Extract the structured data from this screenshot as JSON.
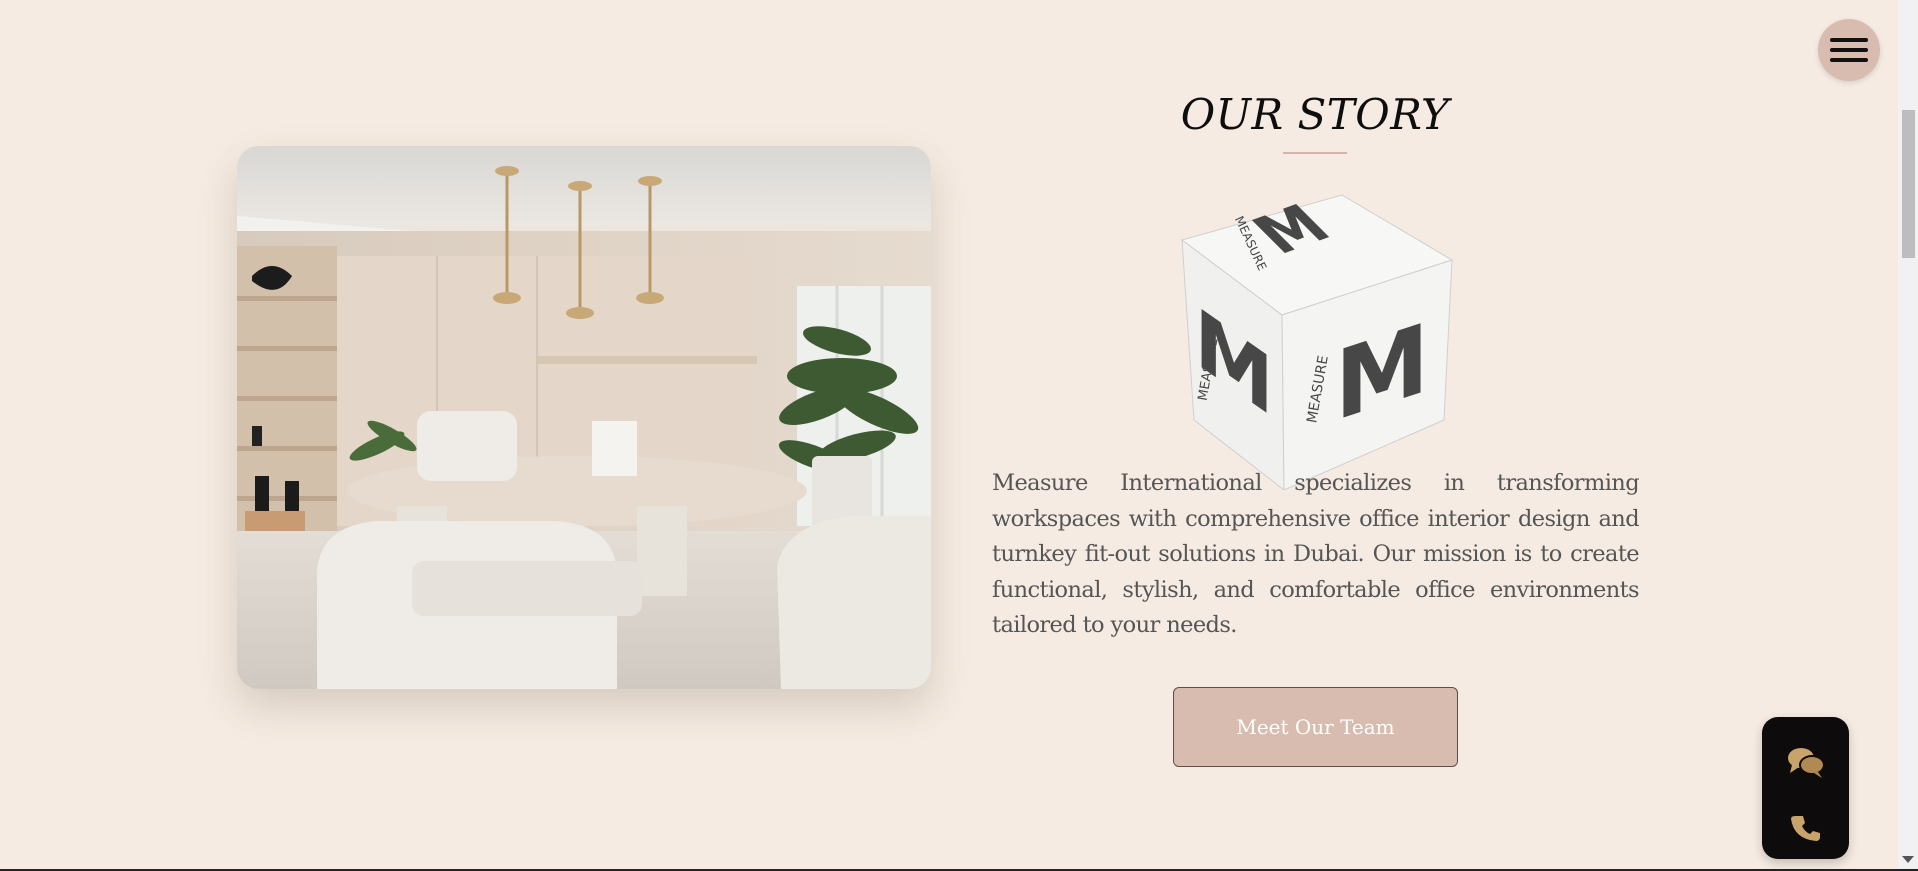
{
  "section": {
    "title": "OUR STORY",
    "paragraph": "Measure International specializes in transforming workspaces with comprehensive office interior design and turnkey fit-out solutions in Dubai. Our mission is to create functional, stylish, and comfortable office environments tailored to your needs.",
    "button_label": "Meet Our Team"
  },
  "cube_logo": {
    "letter": "M",
    "word": "MEASURE"
  },
  "floating": {
    "menu_icon": "hamburger-menu-icon",
    "chat_icon": "chat-bubbles-icon",
    "phone_icon": "phone-icon"
  },
  "colors": {
    "background": "#f5ebe2",
    "accent": "#d8bcb0",
    "widget": "#0d0b0b",
    "icon_gold": "#c9a46a"
  }
}
